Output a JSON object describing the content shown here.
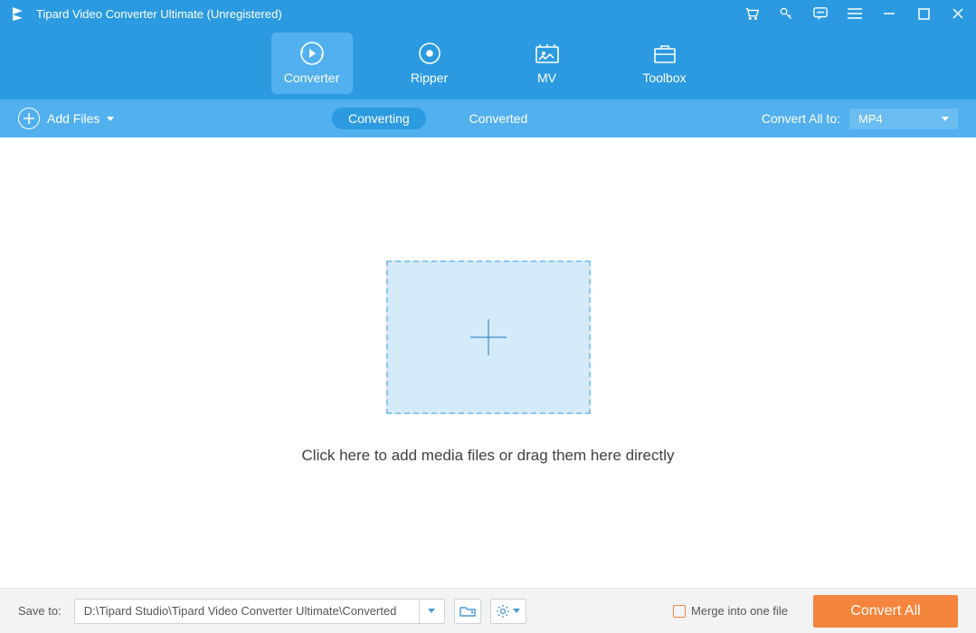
{
  "titlebar": {
    "title": "Tipard Video Converter Ultimate (Unregistered)"
  },
  "nav": {
    "converter": "Converter",
    "ripper": "Ripper",
    "mv": "MV",
    "toolbox": "Toolbox"
  },
  "toolbar": {
    "add_files": "Add Files",
    "converting": "Converting",
    "converted": "Converted",
    "convert_all_to": "Convert All to:",
    "format": "MP4"
  },
  "content": {
    "dropzone_text": "Click here to add media files or drag them here directly"
  },
  "bottombar": {
    "save_to": "Save to:",
    "path": "D:\\Tipard Studio\\Tipard Video Converter Ultimate\\Converted",
    "merge": "Merge into one file",
    "convert_all": "Convert All"
  }
}
